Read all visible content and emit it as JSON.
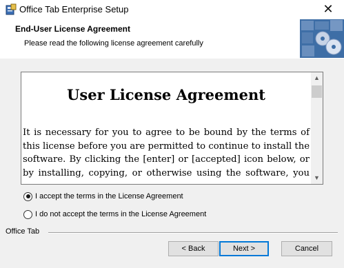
{
  "window": {
    "title": "Office Tab Enterprise Setup",
    "close_symbol": "✕"
  },
  "header": {
    "title": "End-User License Agreement",
    "subtitle": "Please read the following license agreement carefully"
  },
  "license": {
    "heading": "User License Agreement",
    "body": "It is necessary for you to agree to be bound by the terms of this license before you are permitted to continue to install the software. By clicking the [enter] or [accepted] icon below, or by installing, copying, or otherwise using the software, you agree"
  },
  "options": [
    {
      "label": "I accept the terms in the License Agreement",
      "selected": true
    },
    {
      "label": "I do not accept the terms in the License Agreement",
      "selected": false
    }
  ],
  "footer": {
    "group_label": "Office Tab"
  },
  "buttons": {
    "back": "< Back",
    "next": "Next >",
    "cancel": "Cancel"
  },
  "icons": {
    "app": "installer-icon",
    "banner": "cd-discs-banner",
    "scroll_up": "▲",
    "scroll_down": "▼"
  },
  "colors": {
    "accent_border": "#0078d7",
    "background": "#f0f0f0"
  }
}
